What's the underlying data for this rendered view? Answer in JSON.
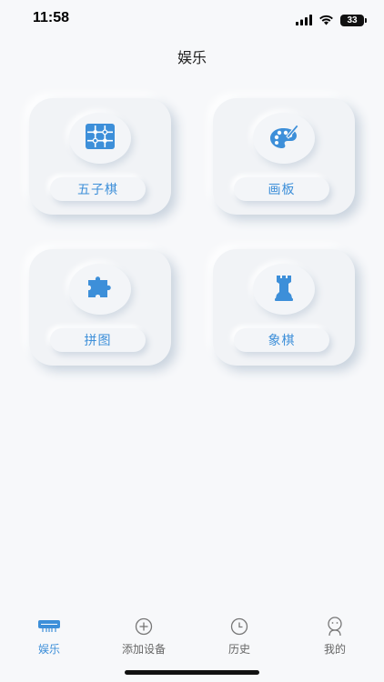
{
  "status_bar": {
    "time": "11:58",
    "battery": "33"
  },
  "header": {
    "title": "娱乐"
  },
  "games": [
    {
      "label": "五子棋",
      "icon": "grid-board-icon"
    },
    {
      "label": "画板",
      "icon": "palette-icon"
    },
    {
      "label": "拼图",
      "icon": "puzzle-icon"
    },
    {
      "label": "象棋",
      "icon": "chess-rook-icon"
    }
  ],
  "tab_bar": {
    "items": [
      {
        "label": "娱乐",
        "icon": "device-icon",
        "active": true
      },
      {
        "label": "添加设备",
        "icon": "add-circle-icon",
        "active": false
      },
      {
        "label": "历史",
        "icon": "clock-icon",
        "active": false
      },
      {
        "label": "我的",
        "icon": "profile-icon",
        "active": false
      }
    ]
  },
  "colors": {
    "accent": "#3d8fd9",
    "background": "#f7f8fa",
    "card": "#f1f3f6",
    "tab_inactive": "#666666"
  }
}
